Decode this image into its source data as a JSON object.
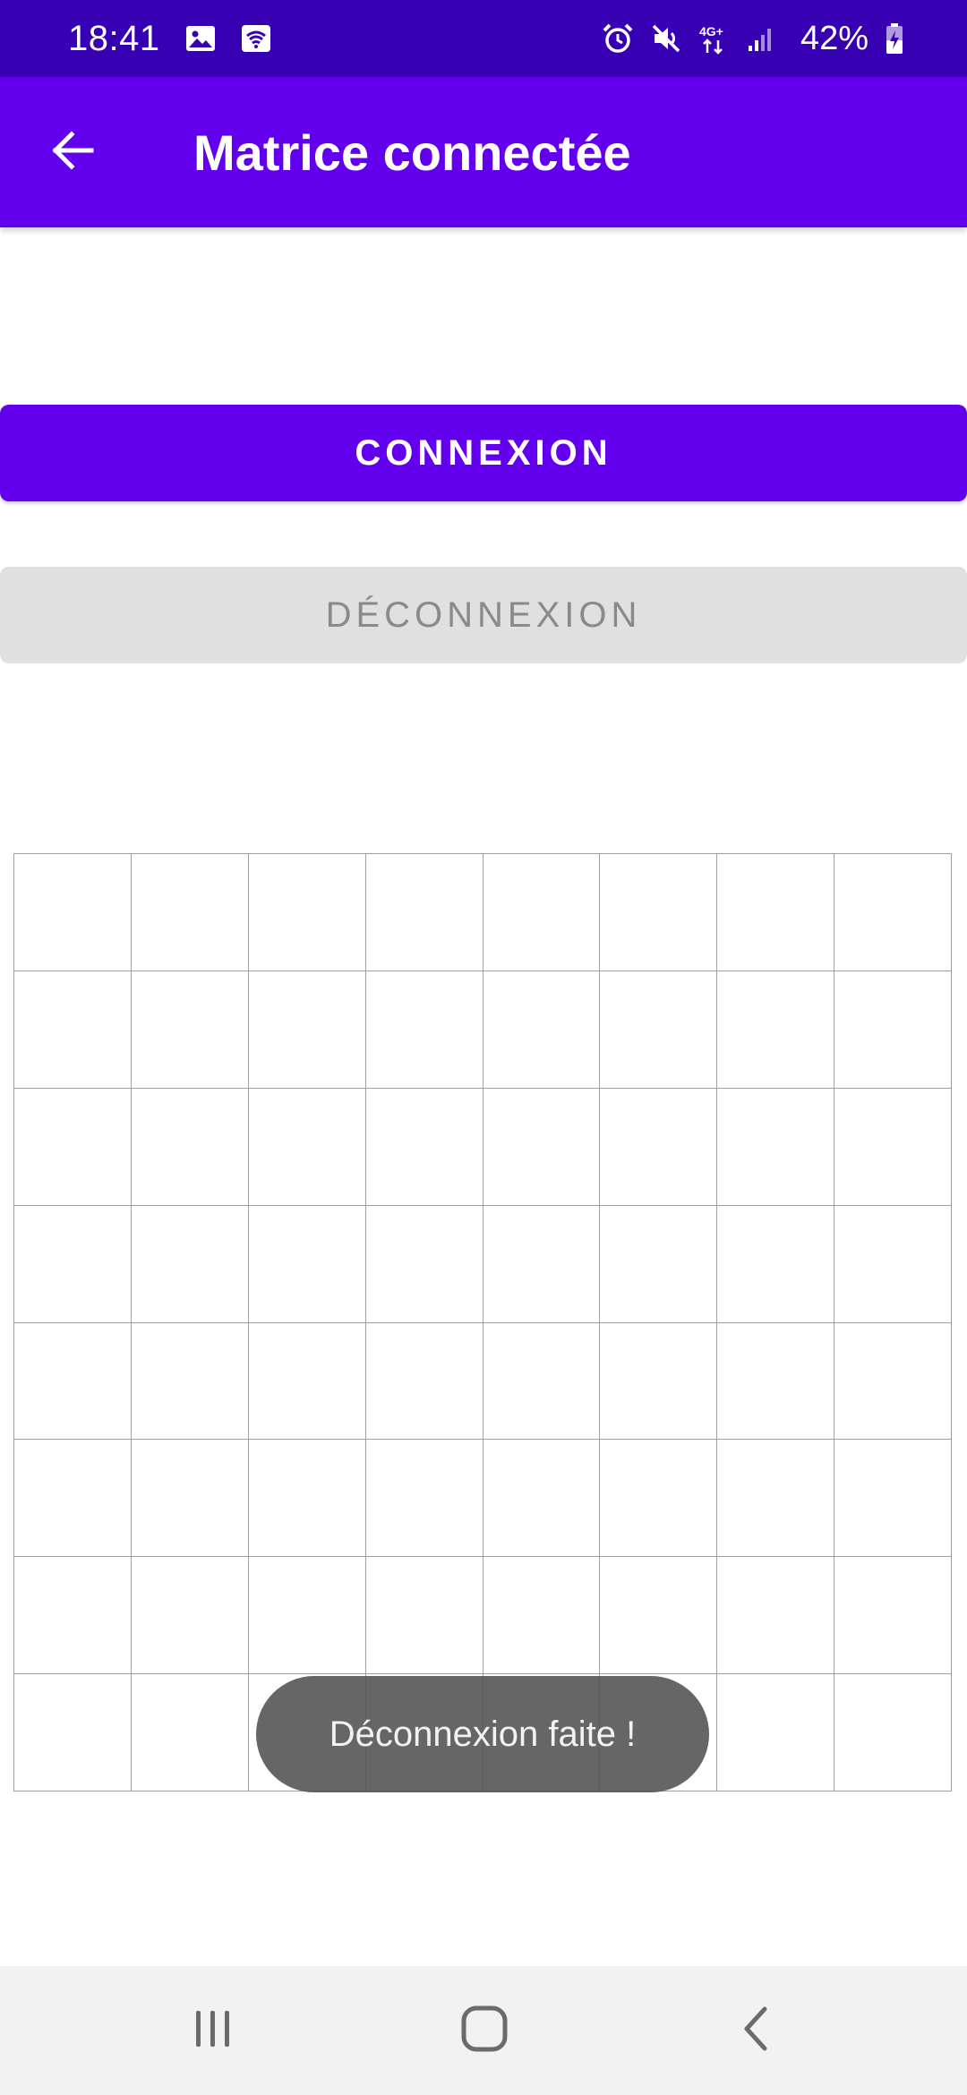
{
  "status_bar": {
    "time": "18:41",
    "battery_percent": "42%",
    "network_label": "4G+",
    "icons": [
      "gallery-icon",
      "wifi-icon",
      "alarm-icon",
      "mute-icon",
      "network-4g-icon",
      "signal-icon",
      "battery-charging-icon"
    ]
  },
  "app_bar": {
    "title": "Matrice connectée",
    "back_icon": "arrow-left-icon"
  },
  "buttons": {
    "connect_label": "CONNEXION",
    "disconnect_label": "DÉCONNEXION"
  },
  "matrix": {
    "rows": 8,
    "columns": 8
  },
  "toast": {
    "message": "Déconnexion faite !"
  },
  "nav_bar": {
    "icons": [
      "recent-apps-icon",
      "home-icon",
      "back-icon"
    ]
  },
  "colors": {
    "status_bar": "#3700b3",
    "app_bar": "#6200ee",
    "primary_button": "#6200ee",
    "disabled_button": "#e0e0e0",
    "grid_line": "#9e9e9e",
    "toast": "#555555"
  }
}
